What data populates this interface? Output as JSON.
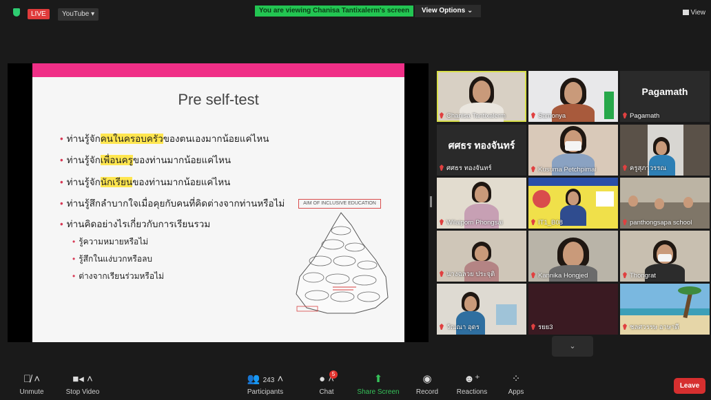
{
  "topbar": {
    "live_label": "LIVE",
    "youtube_label": "YouTube ▾",
    "banner_prefix": "You are viewing",
    "banner_name": "Chanisa Tantixalerm's screen",
    "view_options": "View Options  ⌄",
    "view_label": "View"
  },
  "slide": {
    "title": "Pre self-test",
    "bullets": [
      {
        "pre": "ท่านรู้จัก",
        "hl": "คนในครอบครัว",
        "post": "ของตนเองมากน้อยแค่ไหน"
      },
      {
        "pre": "ท่านรู้จัก",
        "hl": "เพื่อนครู",
        "post": "ของท่านมากน้อยแค่ไหน"
      },
      {
        "pre": "ท่านรู้จัก",
        "hl": "นักเรียน",
        "post": "ของท่านมากน้อยแค่ไหน"
      },
      {
        "pre": "ท่านรู้สึกลำบากใจเมื่อคุยกับคนที่คิดต่างจากท่านหรือไม่",
        "hl": "",
        "post": ""
      },
      {
        "pre": "ท่านคิดอย่างไรเกี่ยวกับการเรียนรวม",
        "hl": "",
        "post": ""
      }
    ],
    "subbullets": [
      "รู้ความหมายหรือไม่",
      "รู้สึกในแง่บวกหรือลบ",
      "ต่างจากเรียนร่วมหรือไม่"
    ],
    "aim_label": "AIM OF INCLUSIVE EDUCATION"
  },
  "participants": [
    {
      "name": "Chanisa Tantixalerm"
    },
    {
      "name": "Samonya"
    },
    {
      "name": "Pagamath",
      "big": "Pagamath"
    },
    {
      "name": "ศศธร ทองจันทร์",
      "big": "ศศธร ทองจันทร์"
    },
    {
      "name": "Kusuma Petchpimai"
    },
    {
      "name": "ครูสุภาวรรณ"
    },
    {
      "name": "Wilaiporn Phongsai"
    },
    {
      "name": "IT1_B08"
    },
    {
      "name": "panthongsapa school"
    },
    {
      "name": "นางฉลวย ประจุติ"
    },
    {
      "name": "Kannika Hongjed"
    },
    {
      "name": "Thongrat"
    },
    {
      "name": "วัณณา อุดร"
    },
    {
      "name": "รยย3"
    },
    {
      "name": "ชลศวรรษ อาษาดี"
    }
  ],
  "more_label": "⌄",
  "controls": {
    "unmute": "Unmute",
    "stop_video": "Stop Video",
    "participants": "Participants",
    "participants_count": "243",
    "chat": "Chat",
    "chat_badge": "5",
    "share_screen": "Share Screen",
    "record": "Record",
    "reactions": "Reactions",
    "apps": "Apps",
    "leave": "Leave"
  },
  "colors": {
    "accent_pink": "#f02f87",
    "share_green": "#36c25a",
    "leave_red": "#d62f2f",
    "highlight": "#ffe64f"
  }
}
